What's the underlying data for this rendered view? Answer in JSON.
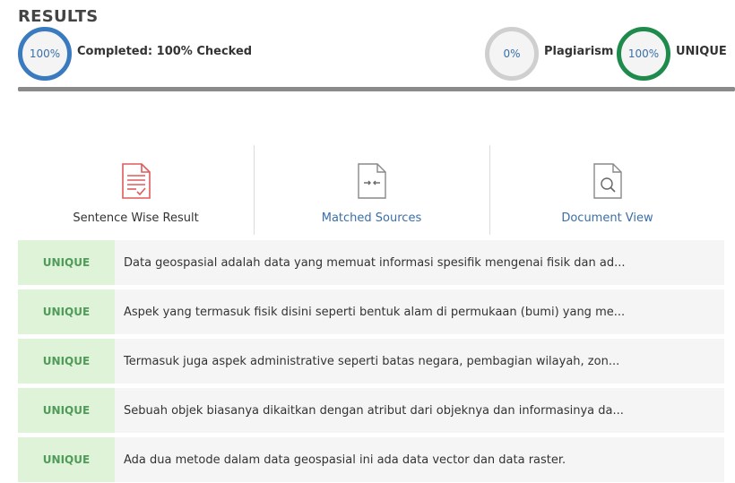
{
  "header": {
    "title": "RESULTS",
    "completed": {
      "value": "100%",
      "label": "Completed: 100% Checked"
    },
    "plagiarism": {
      "value": "0%",
      "label": "Plagiarism"
    },
    "unique": {
      "value": "100%",
      "label": "UNIQUE"
    },
    "progress_percent": 100
  },
  "tabs": [
    {
      "label": "Sentence Wise Result",
      "icon": "sentence-report-icon"
    },
    {
      "label": "Matched Sources",
      "icon": "matched-sources-icon"
    },
    {
      "label": "Document View",
      "icon": "document-search-icon"
    }
  ],
  "results": [
    {
      "status": "UNIQUE",
      "text": "Data geospasial adalah data yang memuat informasi spesifik mengenai fisik dan ad..."
    },
    {
      "status": "UNIQUE",
      "text": "Aspek yang termasuk fisik disini seperti bentuk alam di permukaan (bumi) yang me..."
    },
    {
      "status": "UNIQUE",
      "text": "Termasuk juga aspek administrative seperti batas negara, pembagian wilayah, zon..."
    },
    {
      "status": "UNIQUE",
      "text": "Sebuah objek biasanya dikaitkan dengan atribut dari objeknya dan informasinya da..."
    },
    {
      "status": "UNIQUE",
      "text": "Ada dua metode dalam data geospasial ini ada data vector dan data raster."
    }
  ],
  "colors": {
    "completed_ring": "#3a7bbf",
    "plagiarism_ring": "#cfcfcf",
    "unique_ring": "#1e8a4c",
    "unique_badge_bg": "#dff3d8",
    "unique_badge_text": "#4f9b59"
  }
}
